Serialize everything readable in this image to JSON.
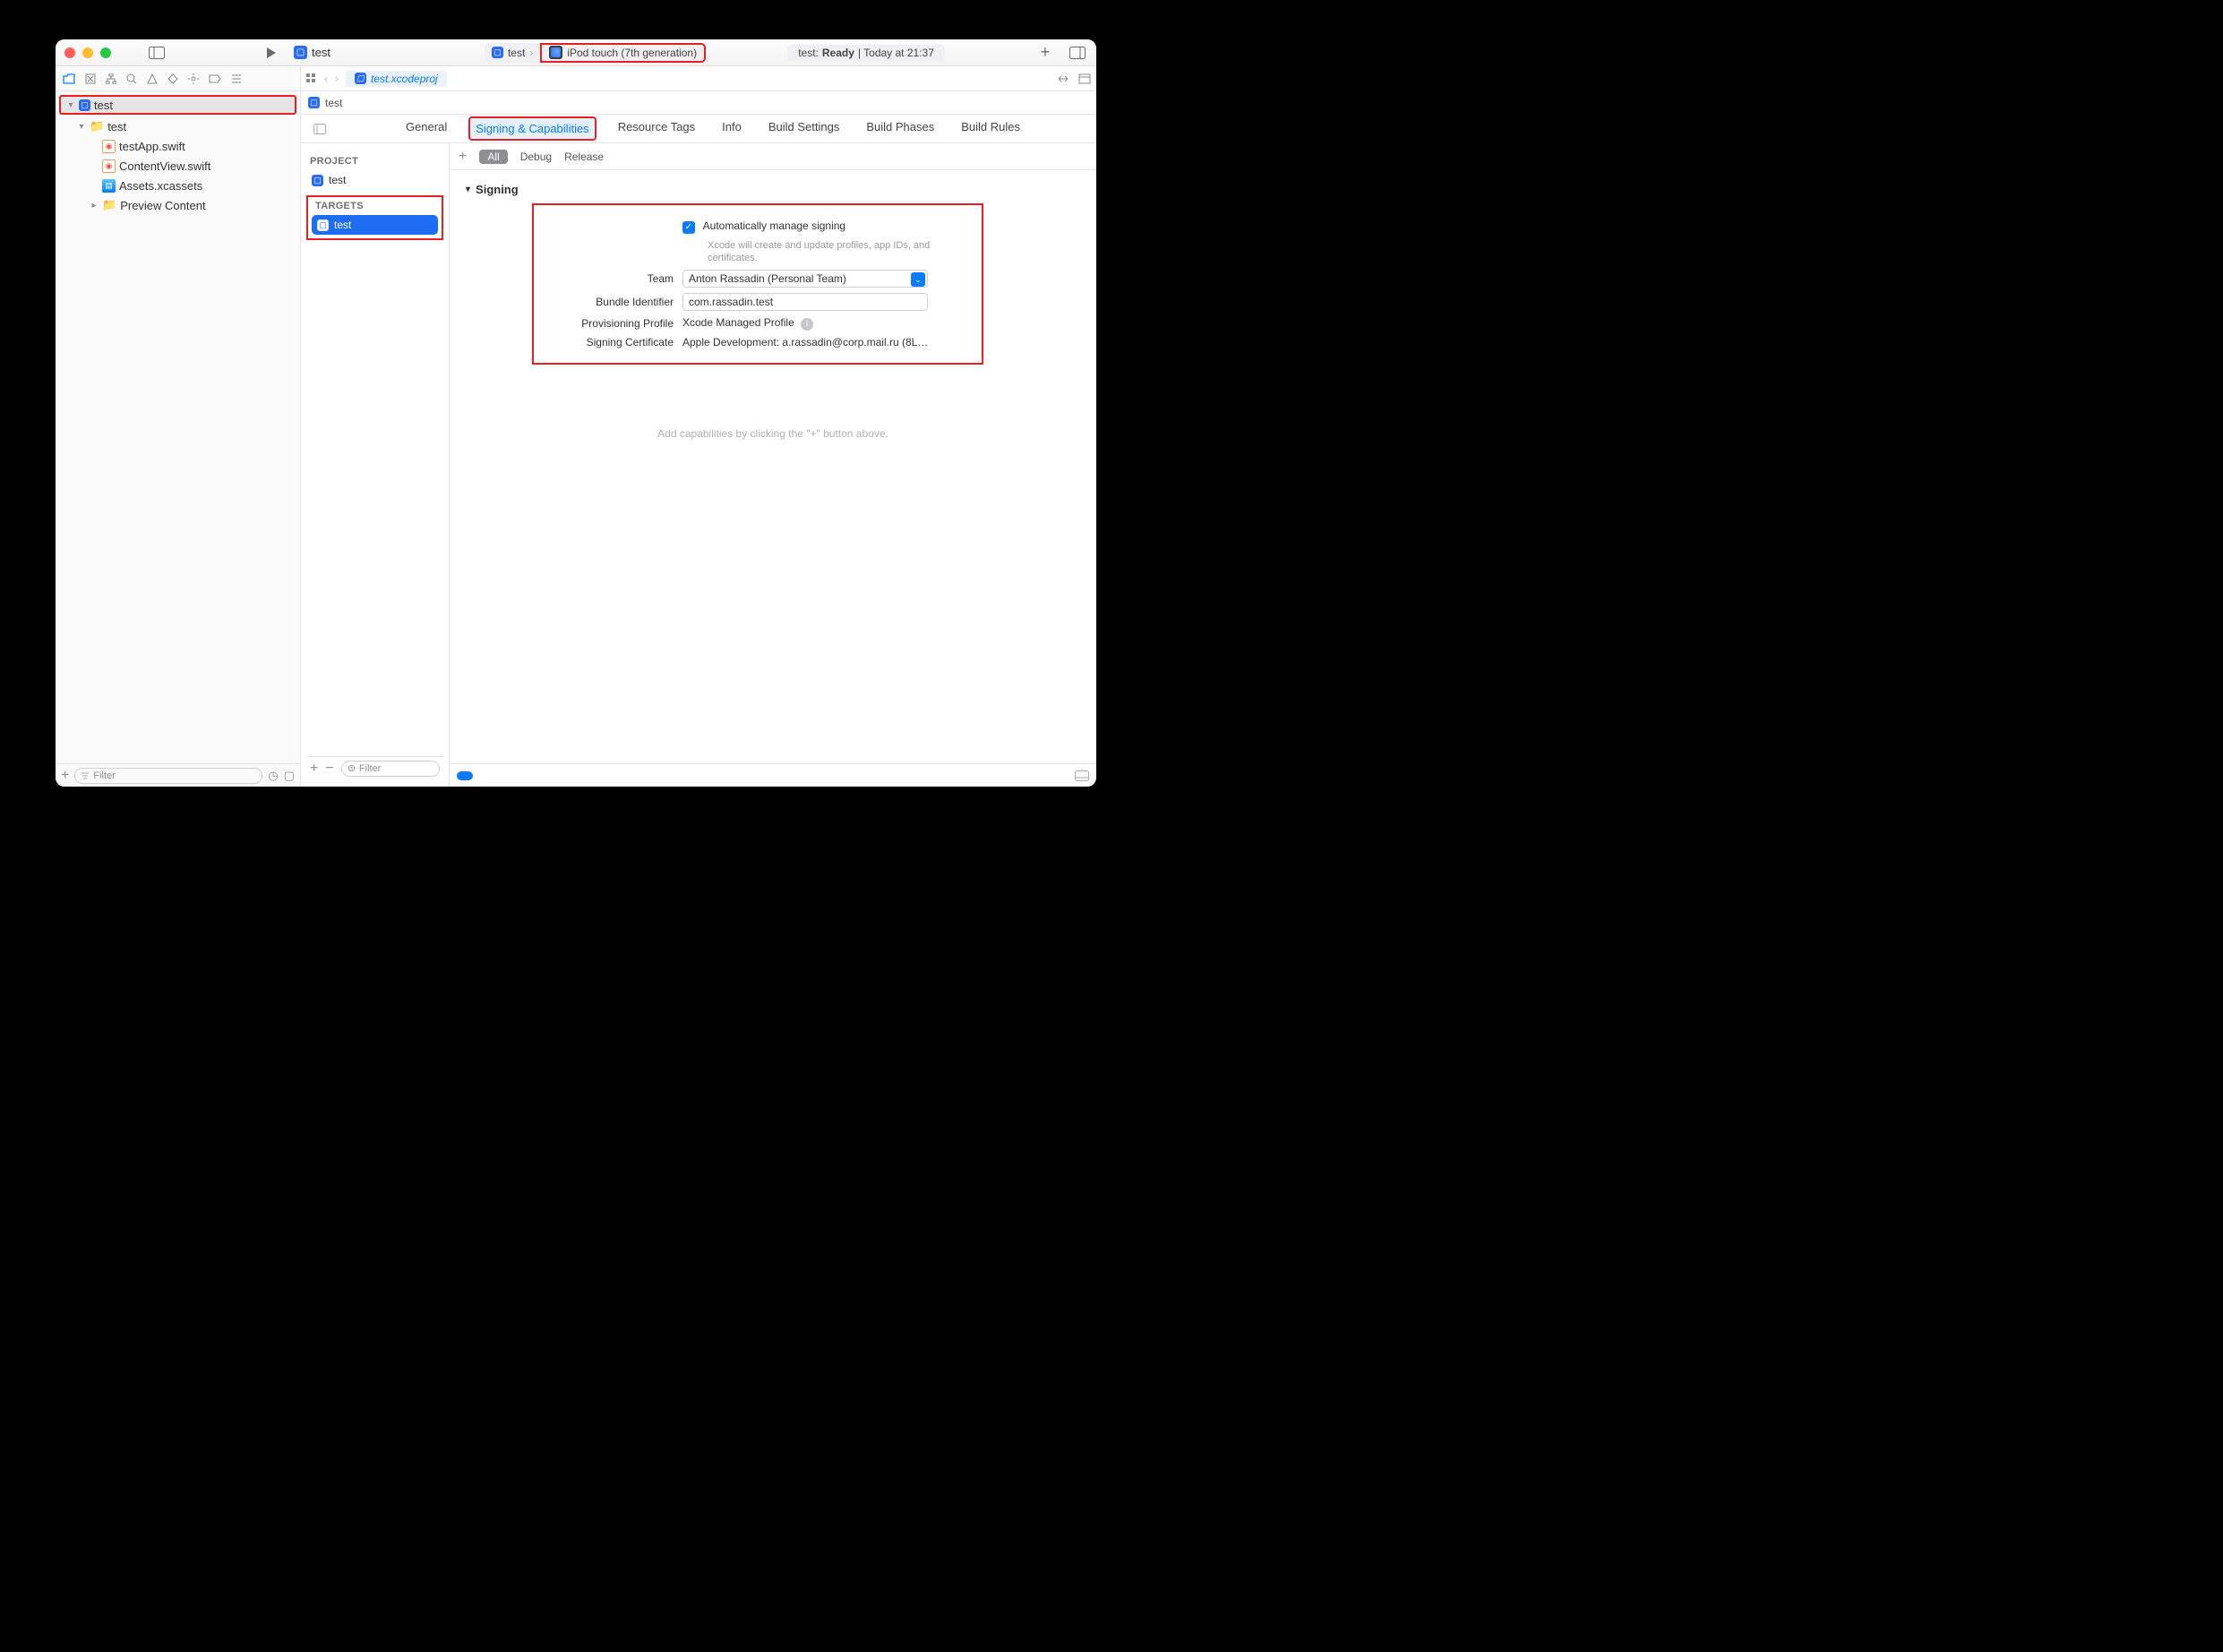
{
  "toolbar": {
    "scheme_name": "test",
    "scheme_device": "iPod touch (7th generation)",
    "status_prefix": "test:",
    "status_state": "Ready",
    "status_time": "| Today at 21:37"
  },
  "jumpbar": {
    "open_tab": "test.xcodeproj"
  },
  "crumbs": {
    "project": "test"
  },
  "navigator": {
    "root": "test",
    "folder": "test",
    "files": [
      "testApp.swift",
      "ContentView.swift",
      "Assets.xcassets",
      "Preview Content"
    ],
    "filter_placeholder": "Filter"
  },
  "project_panel": {
    "heading_project": "PROJECT",
    "project_name": "test",
    "heading_targets": "TARGETS",
    "target_name": "test",
    "filter_placeholder": "Filter"
  },
  "tabs": {
    "items": [
      "General",
      "Signing & Capabilities",
      "Resource Tags",
      "Info",
      "Build Settings",
      "Build Phases",
      "Build Rules"
    ]
  },
  "subtabs": {
    "all": "All",
    "debug": "Debug",
    "release": "Release"
  },
  "signing": {
    "section_title": "Signing",
    "auto_label": "Automatically manage signing",
    "auto_hint": "Xcode will create and update profiles, app IDs, and certificates.",
    "team_label": "Team",
    "team_value": "Anton Rassadin (Personal Team)",
    "bundle_label": "Bundle Identifier",
    "bundle_value": "com.rassadin.test",
    "profile_label": "Provisioning Profile",
    "profile_value": "Xcode Managed Profile",
    "cert_label": "Signing Certificate",
    "cert_value": "Apple Development: a.rassadin@corp.mail.ru (8L…"
  },
  "capabilities_hint": "Add capabilities by clicking the \"+\" button above."
}
